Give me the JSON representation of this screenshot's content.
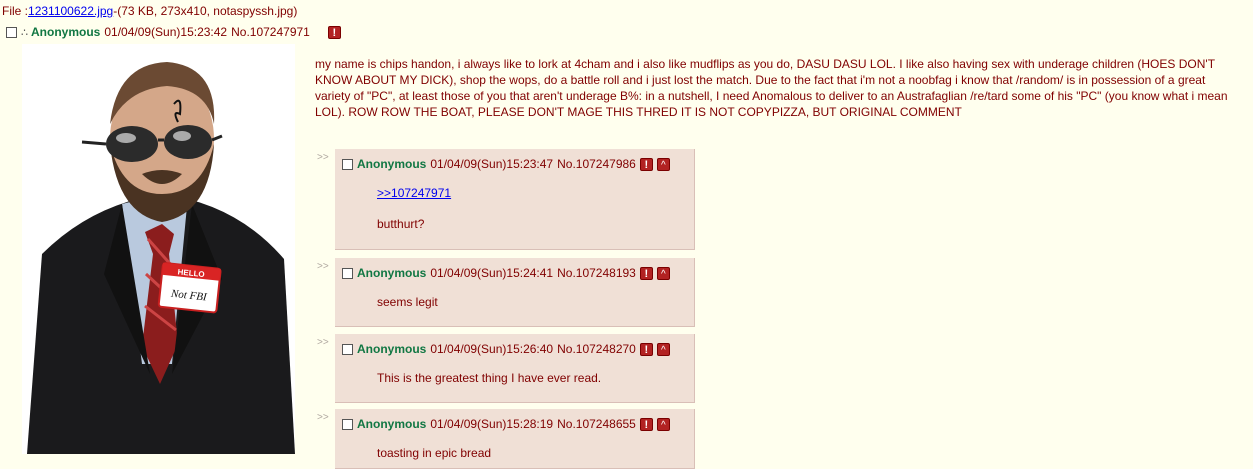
{
  "file": {
    "prefix": "File :",
    "link": "1231100622.jpg",
    "info": "-(73 KB, 273x410, notaspyssh.jpg)"
  },
  "op": {
    "name": "Anonymous",
    "date": "01/04/09(Sun)15:23:42",
    "number": "No.107247971",
    "text": "my name is chips handon, i always like to lork at 4cham and i also like mudflips as you do, DASU DASU LOL. I like also having sex with underage children (HOES DON'T KNOW ABOUT MY DICK), shop the wops, do a battle roll and i just lost the match. Due to the fact that i'm not a noobfag i know that /random/ is in possession of a great variety of \"PC\", at least those of you that aren't underage B%: in a nutshell, I need Anomalous to deliver to an Austrafaglian /re/tard some of his \"PC\" (you know what i mean LOL). ROW ROW THE BOAT, PLEASE DON'T MAGE THIS THRED IT IS NOT COPYPIZZA, BUT ORIGINAL COMMENT",
    "badge_line1": "HELLO",
    "badge_line2": "Not FBI"
  },
  "replies": [
    {
      "name": "Anonymous",
      "date": "01/04/09(Sun)15:23:47",
      "number": "No.107247986",
      "quote": ">>107247971",
      "text": "butthurt?"
    },
    {
      "name": "Anonymous",
      "date": "01/04/09(Sun)15:24:41",
      "number": "No.107248193",
      "text": "seems legit"
    },
    {
      "name": "Anonymous",
      "date": "01/04/09(Sun)15:26:40",
      "number": "No.107248270",
      "text": "This is the greatest thing I have ever read."
    },
    {
      "name": "Anonymous",
      "date": "01/04/09(Sun)15:28:19",
      "number": "No.107248655",
      "text": "toasting in epic bread"
    }
  ],
  "reply_arrows": ">>",
  "report_glyph": "!",
  "up_glyph": "^",
  "colors": {
    "background": "#FFFFEE",
    "text": "#800000",
    "name": "#117743",
    "reply_bg": "#F0E0D6",
    "link": "#0000EE"
  }
}
